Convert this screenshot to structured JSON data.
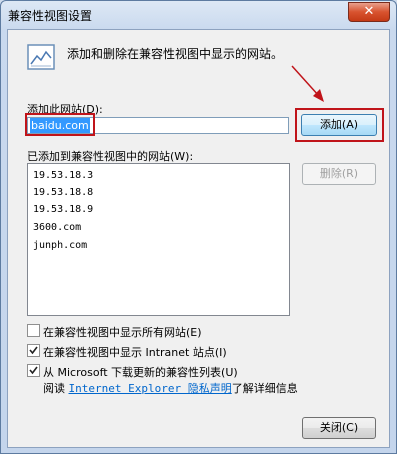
{
  "window": {
    "title": "兼容性视图设置",
    "close_glyph": "✕"
  },
  "header": {
    "text": "添加和删除在兼容性视图中显示的网站。",
    "icon": "compatibility-view-icon"
  },
  "add_site": {
    "label": "添加此网站(D):",
    "value": "baidu.com",
    "button_label": "添加(A)"
  },
  "list": {
    "label": "已添加到兼容性视图中的网站(W):",
    "items": [
      "19.53.18.3",
      "19.53.18.8",
      "19.53.18.9",
      "3600.com",
      "junph.com"
    ],
    "remove_button_label": "删除(R)"
  },
  "options": {
    "show_all": {
      "label": "在兼容性视图中显示所有网站(E)",
      "checked": false
    },
    "intranet": {
      "label": "在兼容性视图中显示 Intranet 站点(I)",
      "checked": true
    },
    "microsoft_list": {
      "label": "从 Microsoft 下载更新的兼容性列表(U)",
      "checked": true
    }
  },
  "info": {
    "prefix": "阅读",
    "link_text": "Internet Explorer 隐私声明",
    "suffix": "了解详细信息"
  },
  "footer": {
    "close_button_label": "关闭(C)"
  },
  "colors": {
    "highlight_red": "#c0141a",
    "link_blue": "#0066cc"
  }
}
